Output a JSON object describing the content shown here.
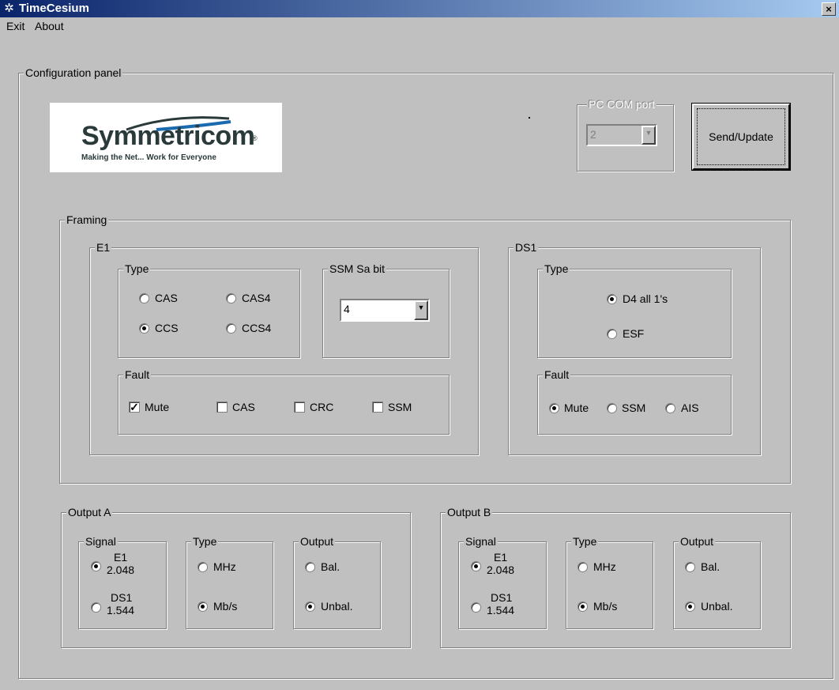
{
  "window": {
    "title": "TimeCesium",
    "close_label": "×"
  },
  "menu": {
    "exit": "Exit",
    "about": "About"
  },
  "config_panel": {
    "label": "Configuration panel"
  },
  "logo": {
    "word": "Symmetricom",
    "tagline": "Making the Net... Work for Everyone"
  },
  "com_port": {
    "label": "PC COM port",
    "value": "2"
  },
  "send_button": "Send/Update",
  "framing": {
    "label": "Framing",
    "e1": {
      "label": "E1",
      "type": {
        "label": "Type",
        "options": [
          "CAS",
          "CAS4",
          "CCS",
          "CCS4"
        ],
        "selected": "CCS"
      },
      "ssm": {
        "label": "SSM Sa bit",
        "value": "4"
      },
      "fault": {
        "label": "Fault",
        "options": [
          "Mute",
          "CAS",
          "CRC",
          "SSM"
        ],
        "checked": [
          "Mute"
        ]
      }
    },
    "ds1": {
      "label": "DS1",
      "type": {
        "label": "Type",
        "options": [
          "D4 all 1's",
          "ESF"
        ],
        "selected": "D4 all 1's"
      },
      "fault": {
        "label": "Fault",
        "options": [
          "Mute",
          "SSM",
          "AIS"
        ],
        "selected": "Mute"
      }
    }
  },
  "output_a": {
    "label": "Output A",
    "signal": {
      "label": "Signal",
      "opt1_top": "E1",
      "opt1_bottom": "2.048",
      "opt2_top": "DS1",
      "opt2_bottom": "1.544",
      "selected": "E1"
    },
    "type": {
      "label": "Type",
      "opt1": "MHz",
      "opt2": "Mb/s",
      "selected": "Mb/s"
    },
    "output": {
      "label": "Output",
      "opt1": "Bal.",
      "opt2": "Unbal.",
      "selected": "Unbal."
    }
  },
  "output_b": {
    "label": "Output B",
    "signal": {
      "label": "Signal",
      "opt1_top": "E1",
      "opt1_bottom": "2.048",
      "opt2_top": "DS1",
      "opt2_bottom": "1.544",
      "selected": "E1"
    },
    "type": {
      "label": "Type",
      "opt1": "MHz",
      "opt2": "Mb/s",
      "selected": "Mb/s"
    },
    "output": {
      "label": "Output",
      "opt1": "Bal.",
      "opt2": "Unbal.",
      "selected": "Unbal."
    }
  }
}
